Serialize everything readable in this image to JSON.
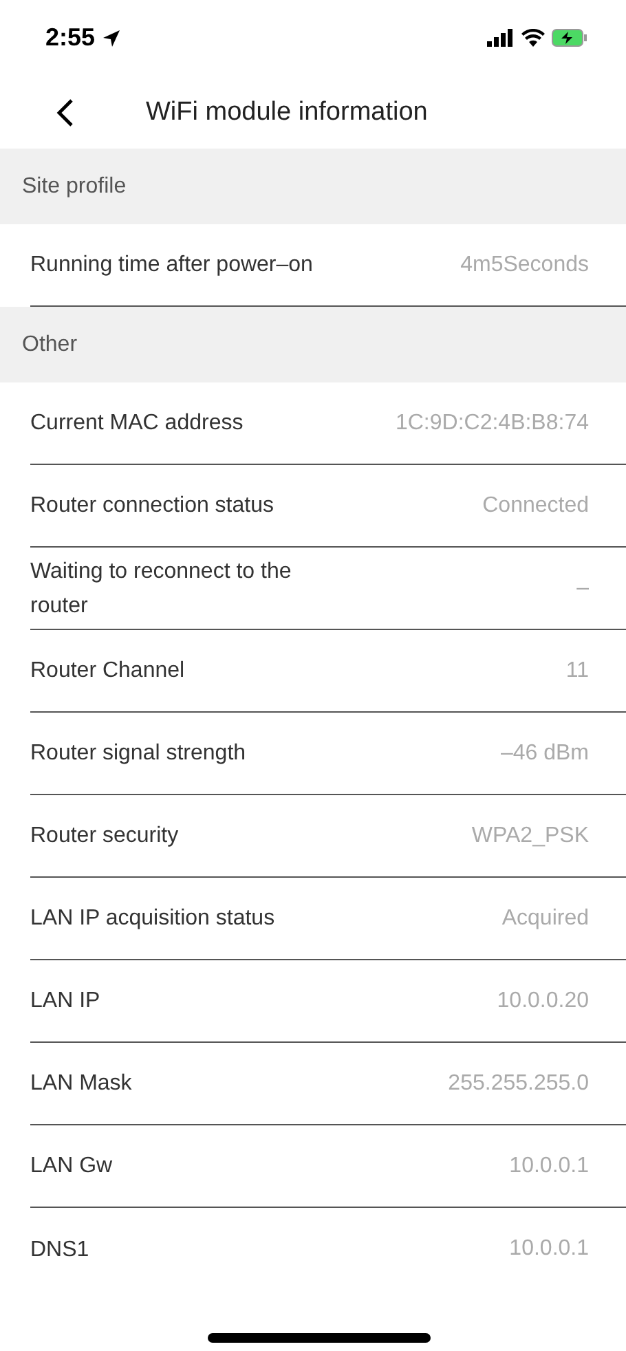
{
  "status_bar": {
    "time": "2:55"
  },
  "header": {
    "title": "WiFi module information"
  },
  "sections": [
    {
      "title": "Site profile",
      "rows": [
        {
          "label": "Running time after power–on",
          "value": "4m5Seconds"
        }
      ]
    },
    {
      "title": "Other",
      "rows": [
        {
          "label": "Current MAC address",
          "value": "1C:9D:C2:4B:B8:74"
        },
        {
          "label": "Router connection status",
          "value": "Connected"
        },
        {
          "label": "Waiting to reconnect to the router",
          "value": "–"
        },
        {
          "label": "Router Channel",
          "value": "11"
        },
        {
          "label": "Router signal strength",
          "value": "–46 dBm"
        },
        {
          "label": "Router security",
          "value": "WPA2_PSK"
        },
        {
          "label": "LAN IP acquisition status",
          "value": "Acquired"
        },
        {
          "label": "LAN IP",
          "value": "10.0.0.20"
        },
        {
          "label": "LAN Mask",
          "value": "255.255.255.0"
        },
        {
          "label": "LAN Gw",
          "value": "10.0.0.1"
        },
        {
          "label": "DNS1",
          "value": "10.0.0.1"
        }
      ]
    }
  ]
}
